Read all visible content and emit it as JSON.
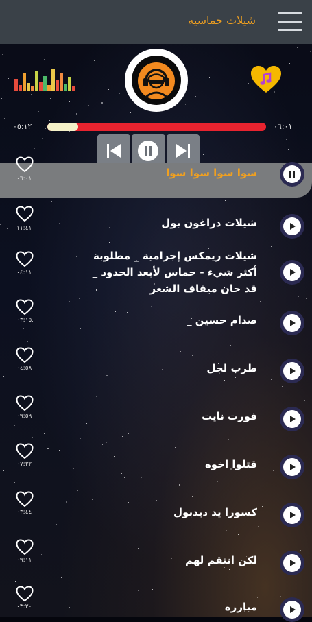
{
  "header": {
    "title": "شيلات حماسيه",
    "menu_icon": "hamburger-menu-icon"
  },
  "player": {
    "elapsed": "٠٥:١٢",
    "total": "٠٦:٠١",
    "progress_fraction": 0.14,
    "logo_icon": "headphones-listener-logo",
    "favorite_icon": "heart-music-note-icon",
    "controls": [
      "previous-icon",
      "pause-icon",
      "next-icon"
    ],
    "colors": {
      "accent": "#f0a020",
      "progress": "#e8232f",
      "progress_fill": "#f4f1c8"
    }
  },
  "songs": [
    {
      "title": "سوا سوا سوا سوا",
      "duration": "٠٦:٠١",
      "active": true
    },
    {
      "title": "شيلات دراغون بول",
      "duration": "١١:٤١",
      "active": false
    },
    {
      "title": "شيلات ريمكس إجرامية _ مطلوبة أكثر شيء - حماس لأبعد الحدود _ قد حان ميقاف الشعر",
      "duration": "٠٤:١١",
      "active": false
    },
    {
      "title": "صدام حسين _",
      "duration": "٠٣:١٥",
      "active": false
    },
    {
      "title": "طرب لجل",
      "duration": "٠٤:٥٨",
      "active": false
    },
    {
      "title": "فورت نايت",
      "duration": "٠٩:٥٩",
      "active": false
    },
    {
      "title": "قتلوا اخوه",
      "duration": "٠٧:٣٢",
      "active": false
    },
    {
      "title": "كسورا يد ديدبول",
      "duration": "٠٣:٤٤",
      "active": false
    },
    {
      "title": "لكن انتقم لهم",
      "duration": "٠٩:١١",
      "active": false
    },
    {
      "title": "مبارزه",
      "duration": "٠٣:٢٠",
      "active": false
    }
  ]
}
